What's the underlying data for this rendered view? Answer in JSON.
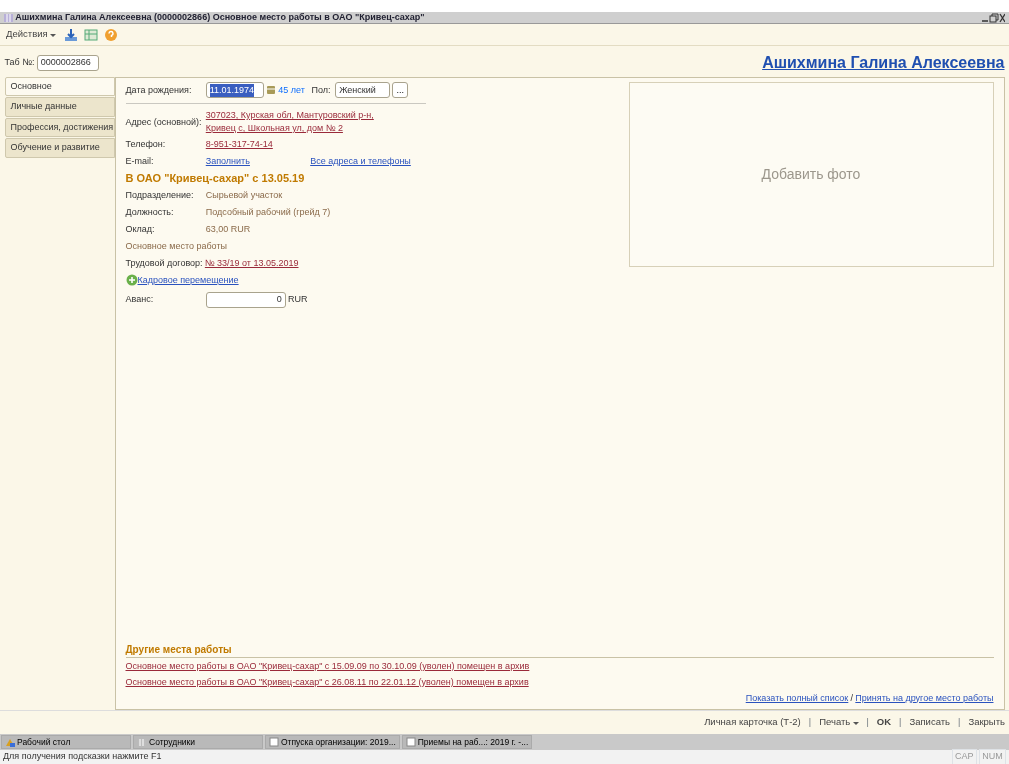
{
  "window": {
    "title": "Ашихмина Галина Алексеевна (0000002866) Основное место работы в ОАО \"Кривец-сахар\""
  },
  "toolbar": {
    "actions_menu": "Действия"
  },
  "tab_number": {
    "label": "Таб №:",
    "value": "0000002866"
  },
  "employee_name": "Ашихмина Галина Алексеевна",
  "tabs": [
    {
      "label": "Основное",
      "selected": true
    },
    {
      "label": "Личные данные",
      "selected": false
    },
    {
      "label": "Профессия, достижения",
      "selected": false
    },
    {
      "label": "Обучение и развитие",
      "selected": false
    }
  ],
  "birth": {
    "label": "Дата рождения:",
    "value": "11.01.1974",
    "age": "45 лет",
    "gender_label": "Пол:",
    "gender": "Женский",
    "gender_button": "..."
  },
  "contacts": [
    {
      "label": "Адрес (основной):",
      "value": "307023, Курская обл, Мантуровский р-н, Кривец с, Школьная ул, дом № 2",
      "kind": "link"
    },
    {
      "label": "Телефон:",
      "value": "8-951-317-74-14",
      "kind": "link"
    },
    {
      "label": "E-mail:",
      "value": "Заполнить",
      "kind": "action",
      "extra": "Все адреса и телефоны"
    }
  ],
  "job": {
    "heading": "В ОАО \"Кривец-сахар\" с 13.05.19",
    "rows": [
      {
        "label": "Подразделение:",
        "value": "Сырьевой участок"
      },
      {
        "label": "Должность:",
        "value": "Подсобный рабочий (грейд 7)"
      },
      {
        "label": "Оклад:",
        "value": "63,00 RUR"
      }
    ],
    "note": "Основное место работы",
    "contract_label": "Трудовой договор:",
    "contract": "№ 33/19 от 13.05.2019",
    "transfer": "Кадровое перемещение",
    "advance_label": "Аванс:",
    "advance": "0",
    "advance_currency": "RUR"
  },
  "photo": {
    "placeholder": "Добавить фото"
  },
  "other_jobs": {
    "heading": "Другие места работы",
    "items": [
      "Основное место работы в ОАО \"Кривец-сахар\" с 15.09.09 по 30.10.09 (уволен) помещен в архив",
      "Основное место работы в ОАО \"Кривец-сахар\" с 26.08.11 по 22.01.12 (уволен) помещен в архив"
    ],
    "footer_links": [
      "Показать полный список",
      "Принять на другое место работы"
    ],
    "footer_separator": "/"
  },
  "button_separator": "|",
  "buttons": [
    {
      "label": "Личная карточка (Т-2)",
      "kind": "plain"
    },
    {
      "label": "Печать",
      "kind": "menu"
    },
    {
      "label": "OK",
      "kind": "default"
    },
    {
      "label": "Записать",
      "kind": "plain"
    },
    {
      "label": "Закрыть",
      "kind": "plain"
    }
  ],
  "taskbar": [
    {
      "label": "Рабочий стол",
      "kind": "desktop"
    },
    {
      "label": "Сотрудники",
      "kind": "list"
    },
    {
      "label": "Отпуска организации: 2019...",
      "kind": "doc"
    },
    {
      "label": "Приемы на раб...: 2019 г. -...",
      "kind": "doc"
    }
  ],
  "status_bar": {
    "hint": "Для получения подсказки нажмите F1",
    "indicators": [
      "CAP",
      "NUM"
    ]
  }
}
